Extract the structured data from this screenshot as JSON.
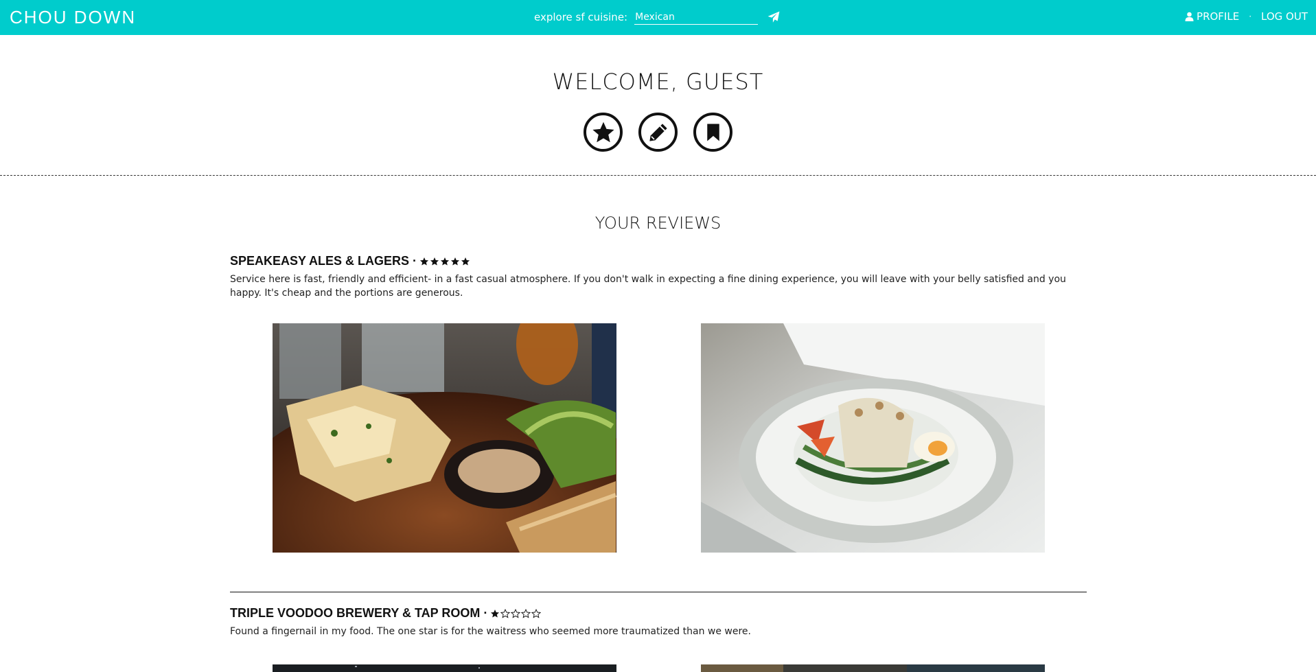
{
  "header": {
    "brand": "CHOU DOWN",
    "search_label": "explore sf cuisine:",
    "search_value": "Mexican",
    "profile_label": "PROFILE",
    "separator": "·",
    "logout_label": "LOG OUT"
  },
  "welcome": {
    "title": "WELCOME, GUEST",
    "icons": [
      "star-icon",
      "pencil-icon",
      "bookmark-icon"
    ]
  },
  "reviews_section": {
    "title": "YOUR REVIEWS",
    "reviews": [
      {
        "restaurant": "SPEAKEASY ALES & LAGERS ·",
        "rating": 5,
        "text": "Service here is fast, friendly and efficient- in a fast casual atmosphere. If you don't walk in expecting a fine dining experience, you will leave with your belly satisfied and you happy. It's cheap and the portions are generous."
      },
      {
        "restaurant": "TRIPLE VOODOO BREWERY & TAP ROOM ·",
        "rating": 1,
        "text": "Found a fingernail in my food. The one star is for the waitress who seemed more traumatized than we were."
      }
    ]
  },
  "colors": {
    "topbar": "#00cccc",
    "text": "#111111"
  }
}
